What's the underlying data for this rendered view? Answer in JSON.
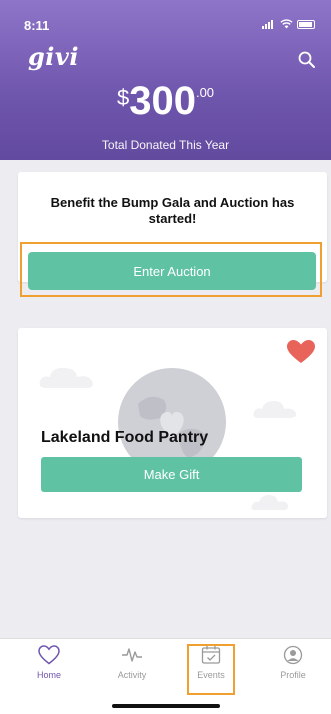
{
  "status_bar": {
    "time": "8:11"
  },
  "header": {
    "logo": "givi",
    "amount": {
      "currency": "$",
      "whole": "300",
      "cents": ".00"
    },
    "total_label": "Total Donated This Year"
  },
  "event_card": {
    "title": "Benefit the Bump Gala and Auction has started!",
    "button_label": "Enter Auction"
  },
  "org_card": {
    "name": "Lakeland Food Pantry",
    "button_label": "Make Gift",
    "favorited": true
  },
  "tabbar": {
    "tabs": [
      {
        "label": "Home",
        "icon": "heart-icon",
        "active": true
      },
      {
        "label": "Activity",
        "icon": "pulse-icon",
        "active": false
      },
      {
        "label": "Events",
        "icon": "calendar-icon",
        "active": false
      },
      {
        "label": "Profile",
        "icon": "profile-icon",
        "active": false
      }
    ]
  },
  "colors": {
    "header_top": "#8e75c9",
    "header_bottom": "#624a9f",
    "accent_green": "#5fc3a3",
    "heart_red": "#e8635a",
    "highlight_orange": "#f0a030"
  }
}
